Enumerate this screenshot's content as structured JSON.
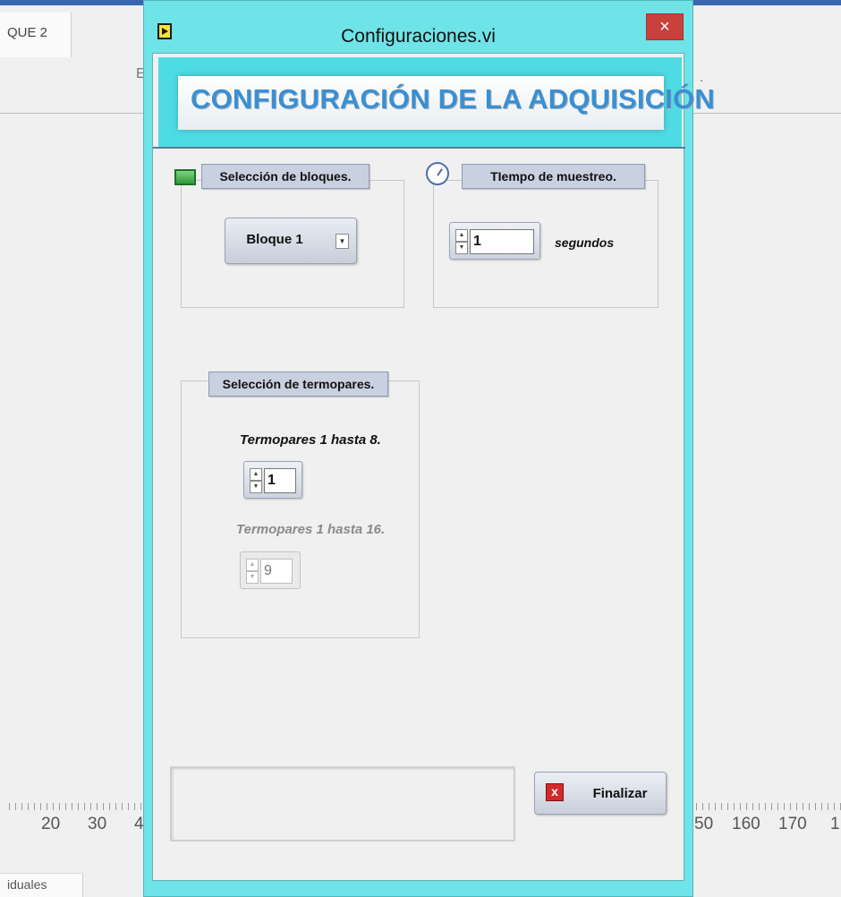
{
  "background": {
    "tab_label": "QUE 2",
    "bottom_tab_label": "iduales",
    "axis_left": [
      "20",
      "30",
      "4"
    ],
    "axis_right": [
      "50",
      "160",
      "170",
      "1"
    ]
  },
  "dialog": {
    "title": "Configuraciones.vi",
    "close_label": "×",
    "banner_title": "CONFIGURACIÓN DE LA ADQUISICIÓN",
    "blocks_group": {
      "legend": "Selección de bloques.",
      "selected": "Bloque 1",
      "dropdown_glyph": "▼"
    },
    "sampling_group": {
      "legend": "TIempo de muestreo.",
      "value": "1",
      "unit": "segundos"
    },
    "thermo_group": {
      "legend": "Selección de termopares.",
      "label_8": "Termopares 1 hasta 8.",
      "value_8": "1",
      "label_16": "Termopares 1 hasta 16.",
      "value_16": "9"
    },
    "finish_button": {
      "icon": "x-icon",
      "icon_glyph": "x",
      "label": "Finalizar"
    },
    "spin_up": "▲",
    "spin_down": "▼"
  },
  "colors": {
    "window_frame": "#6ee3e8",
    "banner_text": "#3b8fd1",
    "close_button": "#c9413c"
  }
}
